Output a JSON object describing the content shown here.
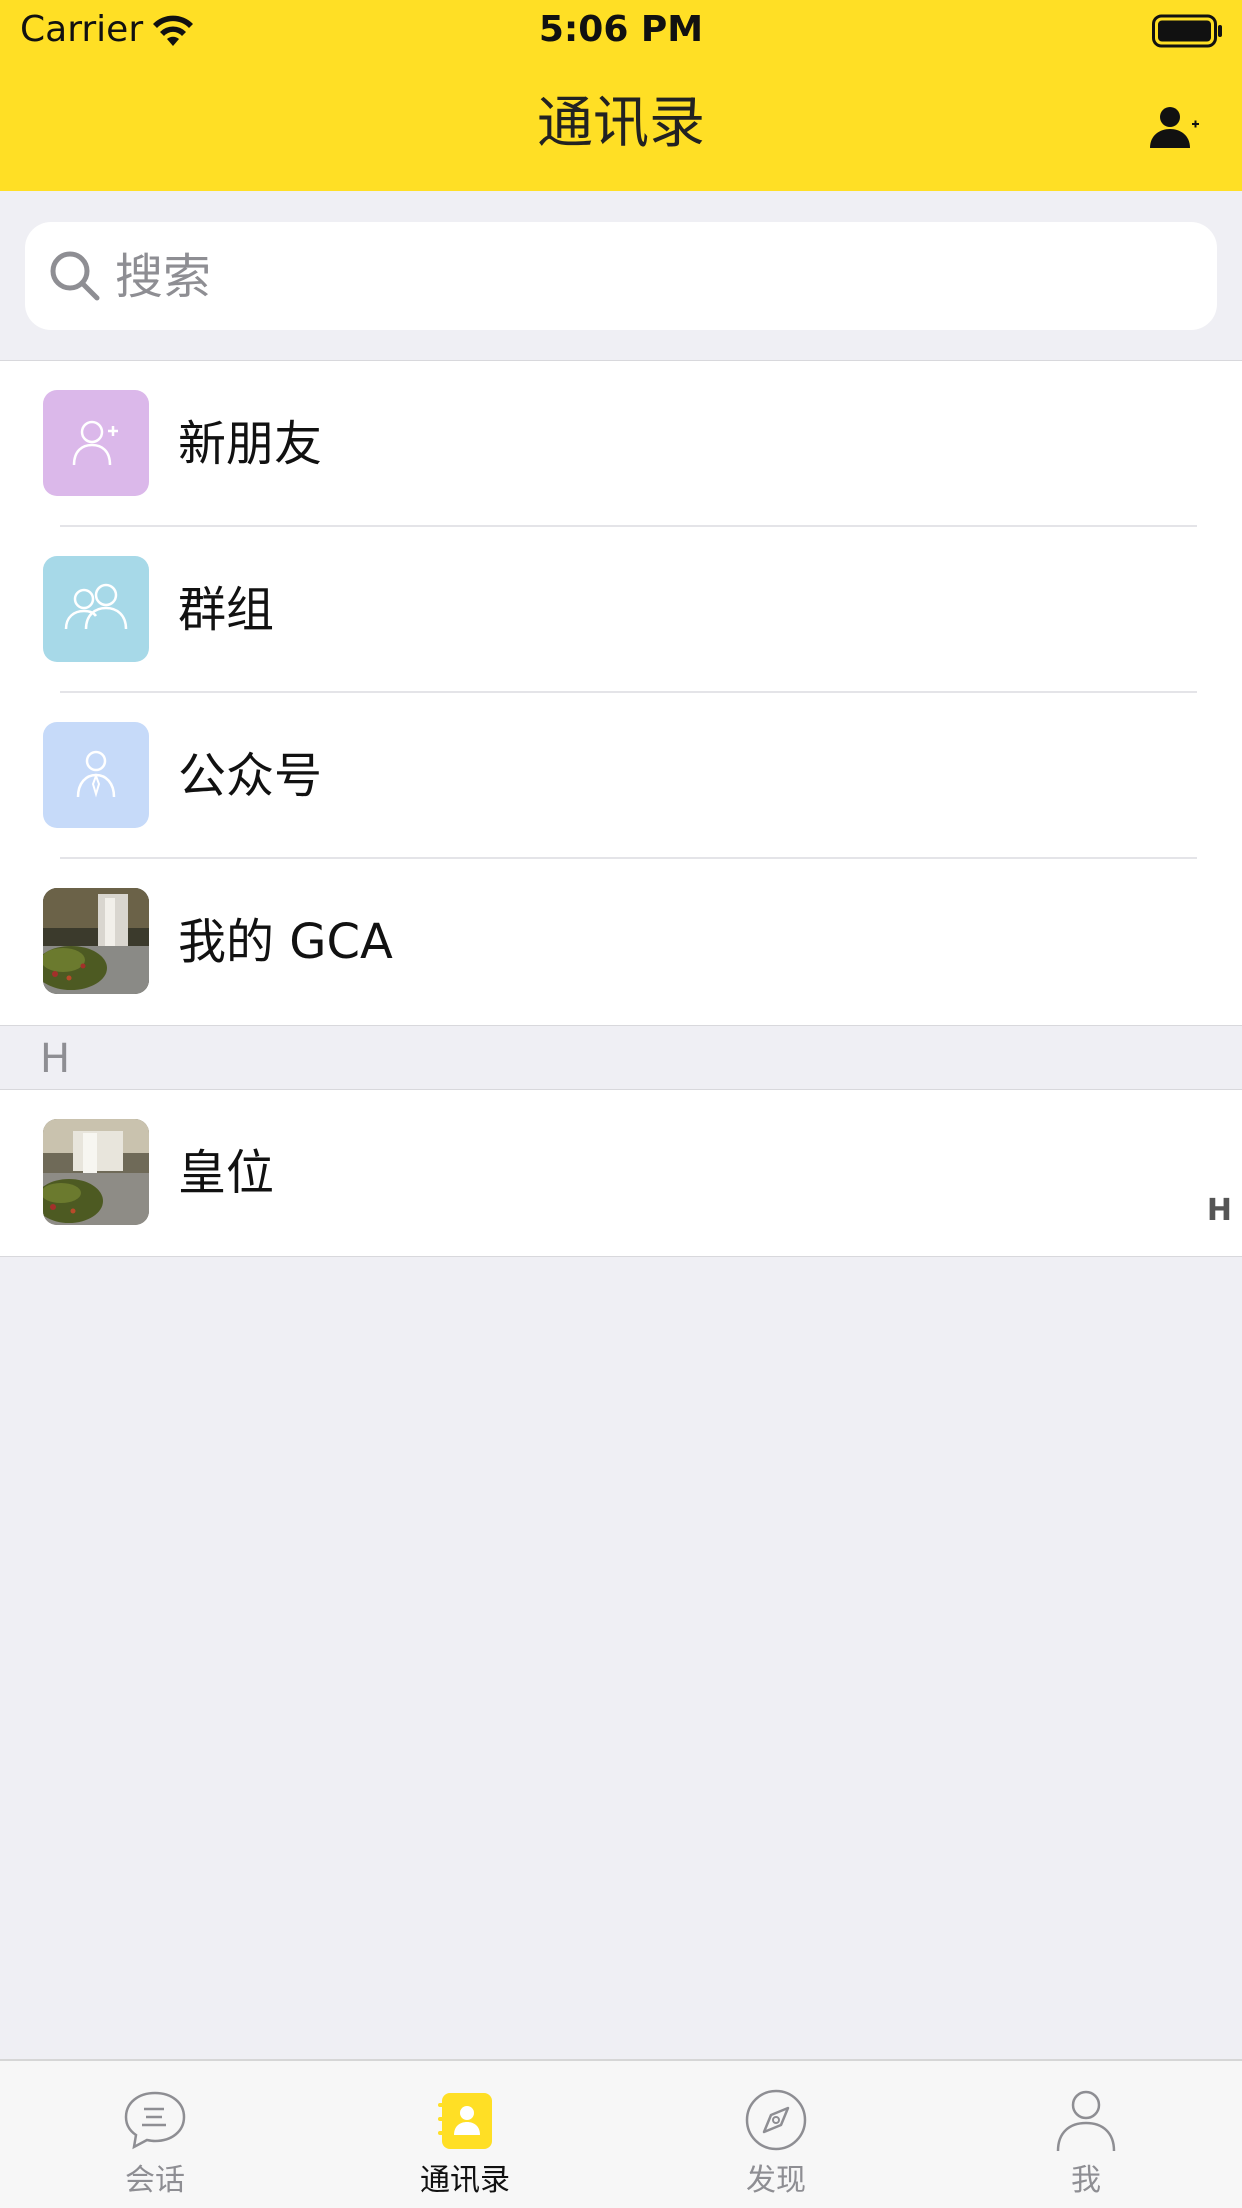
{
  "status_bar": {
    "carrier": "Carrier",
    "time": "5:06 PM"
  },
  "nav": {
    "title": "通讯录",
    "add_icon": "person-add-icon"
  },
  "search": {
    "placeholder": "搜索",
    "icon": "search-icon"
  },
  "top_items": [
    {
      "label": "新朋友",
      "icon": "new-friend-icon",
      "color": "#dbb8ea"
    },
    {
      "label": "群组",
      "icon": "group-icon",
      "color": "#a7d9e8"
    },
    {
      "label": "公众号",
      "icon": "official-account-icon",
      "color": "#c6daf9"
    },
    {
      "label": "我的 GCA",
      "icon": "waterfall-photo-avatar"
    }
  ],
  "sections": [
    {
      "letter": "H",
      "contacts": [
        {
          "name": "皇位",
          "avatar": "waterfall-photo-avatar"
        }
      ]
    }
  ],
  "index_bar": [
    "H"
  ],
  "tabbar": {
    "tabs": [
      {
        "label": "会话",
        "icon": "chat-bubble-icon",
        "active": false
      },
      {
        "label": "通讯录",
        "icon": "contacts-book-icon",
        "active": true
      },
      {
        "label": "发现",
        "icon": "compass-icon",
        "active": false
      },
      {
        "label": "我",
        "icon": "profile-icon",
        "active": false
      }
    ]
  },
  "colors": {
    "header": "#ffdf25",
    "background": "#efeff4"
  }
}
